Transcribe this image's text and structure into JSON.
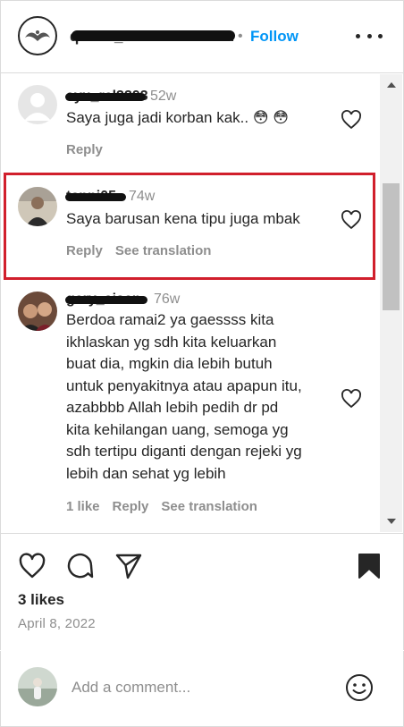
{
  "header": {
    "username": "queen_butik.collection",
    "separator": "•",
    "follow_label": "Follow"
  },
  "comments": [
    {
      "username": "ayu_rel3393",
      "time": "52w",
      "text": "Saya juga jadi korban kak.. 😳 😳",
      "actions": [
        "Reply"
      ]
    },
    {
      "username": "tenni05",
      "time": "74w",
      "text": "Saya barusan kena tipu juga mbak",
      "actions": [
        "Reply",
        "See translation"
      ],
      "highlighted": true
    },
    {
      "username": "gery_aisen",
      "time": "76w",
      "text_lines": [
        "Berdoa ramai2 ya gaessss kita",
        "ikhlaskan yg sdh kita keluarkan",
        "buat dia, mgkin dia lebih butuh",
        "untuk penyakitnya atau apapun itu,",
        "azabbbb Allah lebih pedih dr pd",
        "kita kehilangan uang, semoga yg",
        "sdh tertipu diganti dengan rejeki yg",
        "lebih dan sehat yg lebih"
      ],
      "actions": [
        "1 like",
        "Reply",
        "See translation"
      ]
    }
  ],
  "post": {
    "likes": "3 likes",
    "date": "April 8, 2022"
  },
  "add_comment": {
    "placeholder": "Add a comment..."
  },
  "icons": {
    "like": "heart-icon",
    "comment": "comment-bubble-icon",
    "share": "paper-plane-icon",
    "save": "bookmark-filled-icon",
    "emoji": "smiley-icon",
    "more": "more-dots-icon"
  },
  "colors": {
    "accent_link": "#0095f6",
    "highlight_border": "#d11f2c",
    "muted_text": "#8e8e8e",
    "text": "#262626"
  }
}
